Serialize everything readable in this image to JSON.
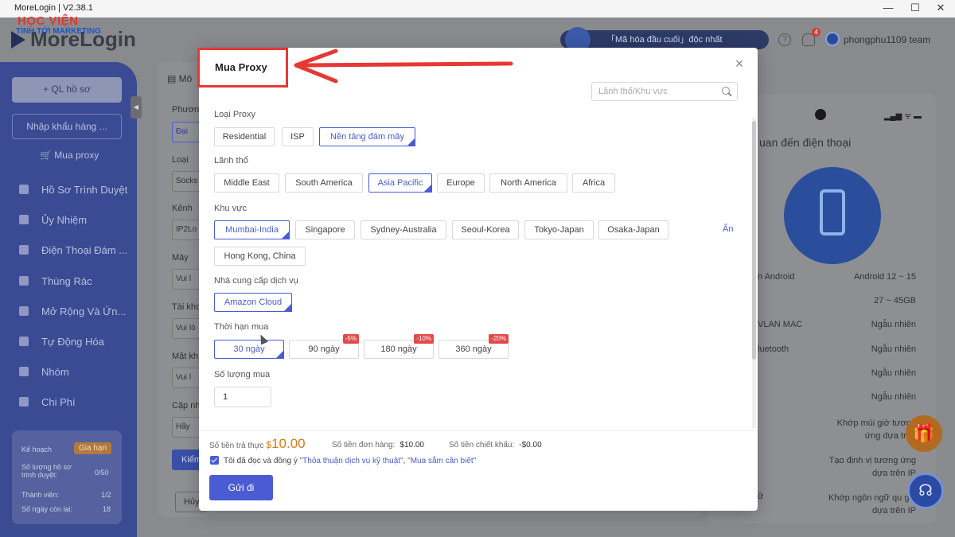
{
  "window": {
    "title": "MoreLogin | V2.38.1",
    "minimize": "—",
    "maximize": "☐",
    "close": "✕"
  },
  "watermark": {
    "line1": "HỌC VIỆN",
    "line2": "TINH TỚI MARKETING"
  },
  "app": {
    "brand": "MoreLogin",
    "promo": "「Mã hóa đầu cuối」độc nhất",
    "help_glyph": "?",
    "notification_count": "4",
    "username": "phongphu1109 team"
  },
  "sidebar": {
    "new_profile": "+ QL hồ sơ",
    "import": "Nhập khẩu hàng ...",
    "buy_proxy": "Mua proxy",
    "items": [
      "Hồ Sơ Trình Duyệt",
      "Ủy Nhiệm",
      "Điện Thoại Đám ...",
      "Thùng Rác",
      "Mở Rộng Và Ứn...",
      "Tự Động Hóa",
      "Nhóm",
      "Chi Phí"
    ],
    "plan": {
      "label": "Kế hoạch",
      "renew": "Gia hạn",
      "profiles_label": "Số lượng hồ sơ trình duyệt:",
      "profiles_value": "0/50",
      "members_label": "Thành viên:",
      "members_value": "1/2",
      "days_label": "Số ngày còn lại:",
      "days_value": "18"
    }
  },
  "background_form": {
    "tab": "Mô",
    "labels": [
      "Phương",
      "Loại",
      "Kênh",
      "Máy",
      "Tài kho",
      "Mật kh",
      "Cập nh"
    ],
    "values": [
      "Đại",
      "Socks",
      "IP2Lo",
      "Vui l",
      "Vui lò",
      "Vui l",
      "Hãy"
    ],
    "check_button": "Kiểm",
    "cancel_button": "Hủy"
  },
  "phone_preview": {
    "status": "▂▄▆ ᯤ ▬",
    "title": "uan đến điện thoại",
    "rows": [
      {
        "left": "n Android",
        "right": "Android 12 ~ 15"
      },
      {
        "left": "",
        "right": "27 ~ 45GB"
      },
      {
        "left": "VLAN MAC",
        "right": "Ngẫu nhiên"
      },
      {
        "left": "luetooth",
        "right": "Ngẫu nhiên"
      },
      {
        "left": "",
        "right": "Ngẫu nhiên"
      },
      {
        "left": "",
        "right": "Ngẫu nhiên"
      },
      {
        "left": "",
        "right": "Khớp múi giờ tương ứng dựa trên"
      },
      {
        "left": "",
        "right": "Tạo định vị tương ứng dựa trên IP"
      },
      {
        "left": "ữ",
        "right": "Khớp ngôn ngữ qu gia dựa trên IP"
      }
    ]
  },
  "floating": {
    "gift": "🎁",
    "support": "☊"
  },
  "modal": {
    "title": "Mua Proxy",
    "close": "×",
    "search_placeholder": "Lãnh thổ/Khu vực",
    "proxy_type": {
      "label": "Loại Proxy",
      "options": [
        "Residential",
        "ISP",
        "Nền tảng đám mây"
      ],
      "selected": "Nền tảng đám mây"
    },
    "territory": {
      "label": "Lãnh thổ",
      "options": [
        "Middle East",
        "South America",
        "Asia Pacific",
        "Europe",
        "North America",
        "Africa"
      ],
      "selected": "Asia Pacific"
    },
    "region": {
      "label": "Khu vực",
      "options": [
        "Mumbai-India",
        "Singapore",
        "Sydney-Australia",
        "Seoul-Korea",
        "Tokyo-Japan",
        "Osaka-Japan",
        "Hong Kong, China"
      ],
      "selected": "Mumbai-India",
      "toggle": "Ẩn"
    },
    "provider": {
      "label": "Nhà cung cấp dịch vụ",
      "options": [
        "Amazon Cloud"
      ],
      "selected": "Amazon Cloud"
    },
    "duration": {
      "label": "Thời hạn mua",
      "options": [
        {
          "label": "30 ngày",
          "discount": ""
        },
        {
          "label": "90 ngày",
          "discount": "-5%"
        },
        {
          "label": "180 ngày",
          "discount": "-10%"
        },
        {
          "label": "360 ngày",
          "discount": "-20%"
        }
      ],
      "selected": "30 ngày"
    },
    "quantity": {
      "label": "Số lượng mua",
      "value": "1"
    },
    "summary": {
      "actual_label": "Số tiền trả thực",
      "actual_currency": "$",
      "actual_value": "10.00",
      "order_label": "Số tiền đơn hàng:",
      "order_value": "$10.00",
      "discount_label": "Số tiền chiết khấu:",
      "discount_value": "-$0.00"
    },
    "agreement": {
      "text": "Tôi đã đọc và đồng ý",
      "link1": "\"Thỏa thuận dịch vụ kỹ thuật\"",
      "separator": ",",
      "link2": "\"Mua sắm cần biết\"",
      "checked": true
    },
    "submit": "Gửi đi"
  },
  "colors": {
    "accent": "#4a5bd3",
    "annotation": "#e53935",
    "price": "#e07a16",
    "discount_badge": "#e24a4a",
    "sidebar": "#3a4a93"
  }
}
